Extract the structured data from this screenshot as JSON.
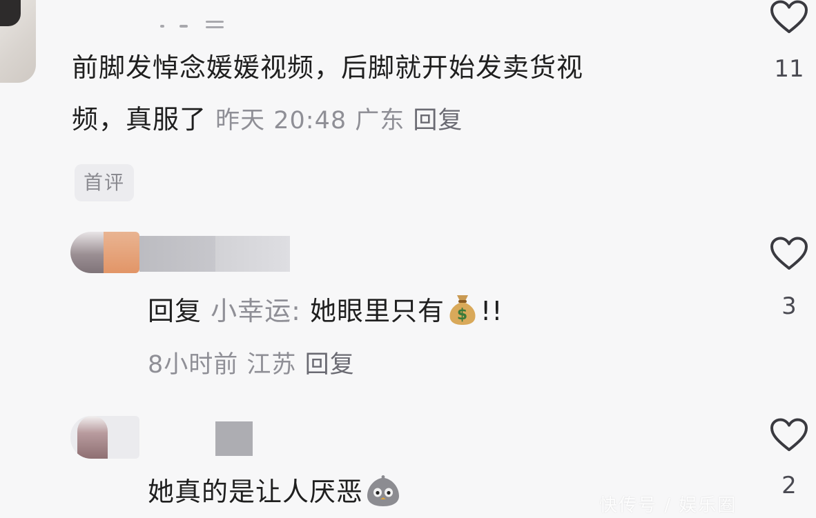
{
  "comments": [
    {
      "text_line1": "前脚发悼念媛媛视频，后脚就开始发卖货视",
      "text_line2": "频，真服了",
      "time": "昨天 20:48",
      "location": "广东",
      "reply_label": "回复",
      "like_count": "11",
      "tag": "首评"
    },
    {
      "reply_prefix": "回复",
      "reply_to": "小幸运:",
      "text": "她眼里只有",
      "emoji_icon": "money-bag-icon",
      "text_suffix": "!!",
      "time": "8小时前",
      "location": "江苏",
      "reply_label": "回复",
      "like_count": "3"
    },
    {
      "text": "她真的是让人厌恶",
      "emoji_icon": "ghost-face-icon",
      "like_count": "2"
    }
  ],
  "colors": {
    "background": "#f7f7f8",
    "text": "#1f1f1f",
    "meta": "#8f8f96",
    "heart_outline": "#3a3a40",
    "tag_bg": "#ececef"
  },
  "watermark": "快传号 / 娱乐圈"
}
